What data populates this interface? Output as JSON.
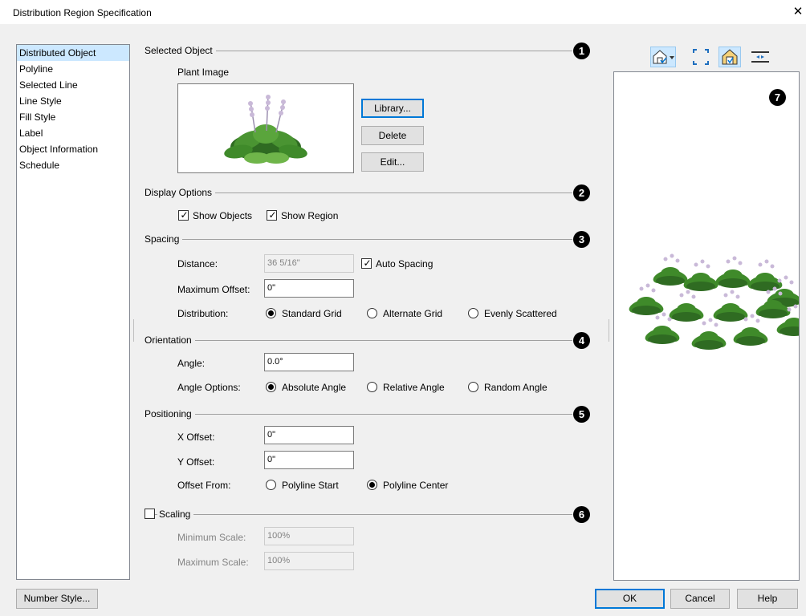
{
  "window": {
    "title": "Distribution Region Specification",
    "close_glyph": "✕"
  },
  "nav": {
    "items": [
      {
        "label": "Distributed Object",
        "selected": true
      },
      {
        "label": "Polyline"
      },
      {
        "label": "Selected Line"
      },
      {
        "label": "Line Style"
      },
      {
        "label": "Fill Style"
      },
      {
        "label": "Label"
      },
      {
        "label": "Object Information"
      },
      {
        "label": "Schedule"
      }
    ]
  },
  "selected_object": {
    "title": "Selected Object",
    "callout": "1",
    "plant_image_label": "Plant Image",
    "library_label": "Library...",
    "delete_label": "Delete",
    "edit_label": "Edit..."
  },
  "display_options": {
    "title": "Display Options",
    "callout": "2",
    "show_objects_label": "Show Objects",
    "show_objects_checked": true,
    "show_region_label": "Show Region",
    "show_region_checked": true
  },
  "spacing": {
    "title": "Spacing",
    "callout": "3",
    "distance_label": "Distance:",
    "distance_value": "36 5/16\"",
    "auto_spacing_label": "Auto Spacing",
    "auto_spacing_checked": true,
    "max_offset_label": "Maximum Offset:",
    "max_offset_value": "0\"",
    "distribution_label": "Distribution:",
    "distribution_options": [
      "Standard Grid",
      "Alternate Grid",
      "Evenly Scattered"
    ],
    "distribution_selected": "Standard Grid"
  },
  "orientation": {
    "title": "Orientation",
    "callout": "4",
    "angle_label": "Angle:",
    "angle_value": "0.0°",
    "angle_options_label": "Angle Options:",
    "angle_options": [
      "Absolute Angle",
      "Relative Angle",
      "Random Angle"
    ],
    "angle_selected": "Absolute Angle"
  },
  "positioning": {
    "title": "Positioning",
    "callout": "5",
    "x_offset_label": "X Offset:",
    "x_offset_value": "0\"",
    "y_offset_label": "Y Offset:",
    "y_offset_value": "0\"",
    "offset_from_label": "Offset From:",
    "offset_from_options": [
      "Polyline Start",
      "Polyline Center"
    ],
    "offset_from_selected": "Polyline Center"
  },
  "scaling": {
    "title": "Scaling",
    "callout": "6",
    "checked": false,
    "min_scale_label": "Minimum Scale:",
    "min_scale_value": "100%",
    "max_scale_label": "Maximum Scale:",
    "max_scale_value": "100%"
  },
  "preview": {
    "callout": "7",
    "toolbar_icons": [
      "display-options-icon",
      "fill-window-icon",
      "view-toggle-icon",
      "preview-options-icon"
    ]
  },
  "footer": {
    "number_style_label": "Number Style...",
    "ok_label": "OK",
    "cancel_label": "Cancel",
    "help_label": "Help"
  },
  "colors": {
    "dialog_bg": "#f0f0f0",
    "selection": "#cce8ff",
    "focus_border": "#0078d7",
    "plant_leaf": "#3f8a2a",
    "plant_flower": "#c9b9d8"
  }
}
